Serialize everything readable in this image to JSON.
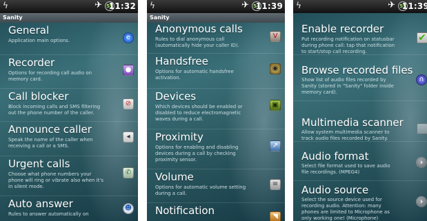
{
  "screens": [
    {
      "status": {
        "battery": "55",
        "time": "11:32"
      },
      "title": "Sanity",
      "items": [
        {
          "title": "General",
          "subtitle": "Application main options.",
          "icon": "globe-icon"
        },
        {
          "title": "Recorder",
          "subtitle": "Options for recording call audio on\nmemory card.",
          "icon": "microphone-icon"
        },
        {
          "title": "Call blocker",
          "subtitle": "Block incoming calls and SMS filtering\nout the phone number of the caller.",
          "icon": "block-icon"
        },
        {
          "title": "Announce caller",
          "subtitle": "Speak the name of the caller when\nreceiving a call or a SMS.",
          "icon": "speaker-icon"
        },
        {
          "title": "Urgent calls",
          "subtitle": "Choose what phone numbers your\nphone will ring or vibrate also when it's\nin silent mode.",
          "icon": "phone-icon"
        },
        {
          "title": "Auto answer",
          "subtitle": "Rules to answer automatically on",
          "icon": "auto-answer-icon"
        }
      ]
    },
    {
      "status": {
        "battery": "54",
        "time": "11:39"
      },
      "title": "Sanity",
      "items": [
        {
          "title": "Anonymous calls",
          "subtitle": "Rules to dial anonymous call\n(automatically hide your caller ID).",
          "icon": "anonymous-icon"
        },
        {
          "title": "Handsfree",
          "subtitle": "Options for automatic handsfree\nactivation.",
          "icon": "handsfree-icon"
        },
        {
          "title": "Devices",
          "subtitle": "Which devices should be enabled or\ndisabled to reduce electromagnetic\nwaves during a call.",
          "icon": "devices-icon"
        },
        {
          "title": "Proximity",
          "subtitle": "Options for enabling and disabling\ndevices during a call by checking\nproximity sensor.",
          "icon": "proximity-icon"
        },
        {
          "title": "Volume",
          "subtitle": "Options for automatic volume setting\nduring a call.",
          "icon": "volume-icon"
        },
        {
          "title": "Notification",
          "subtitle": "",
          "icon": "notification-icon"
        }
      ]
    },
    {
      "status": {
        "battery": "55",
        "time": "11:39"
      },
      "items": [
        {
          "title": "Enable recorder",
          "subtitle": "Put recording notification on statusbar\nduring phone call: tap that notification\nto start/stop call recording.",
          "control": "checkbox",
          "checked": true
        },
        {
          "title": "Browse recorded files",
          "subtitle": "Show list of audio files recorded by\nSanity (stored in \"Sanity\" folder inside\nmemory card).",
          "control": "icon",
          "icon": "headphones-icon"
        },
        {
          "title": "Multimedia scanner",
          "subtitle": "Allow system multimedia scanner to\ntrack audio files recorded by Sanity.",
          "control": "checkbox",
          "checked": false
        },
        {
          "title": "Audio format",
          "subtitle": "Select file format used to save audio\nfile recordings. (MPEG4)",
          "control": "chevron"
        },
        {
          "title": "Audio source",
          "subtitle": "Select the source device used for\nrecording audio. Attention: many\nphones are limited to Microphone as\nonly working one! (Microphone)",
          "control": "chevron"
        }
      ]
    }
  ]
}
